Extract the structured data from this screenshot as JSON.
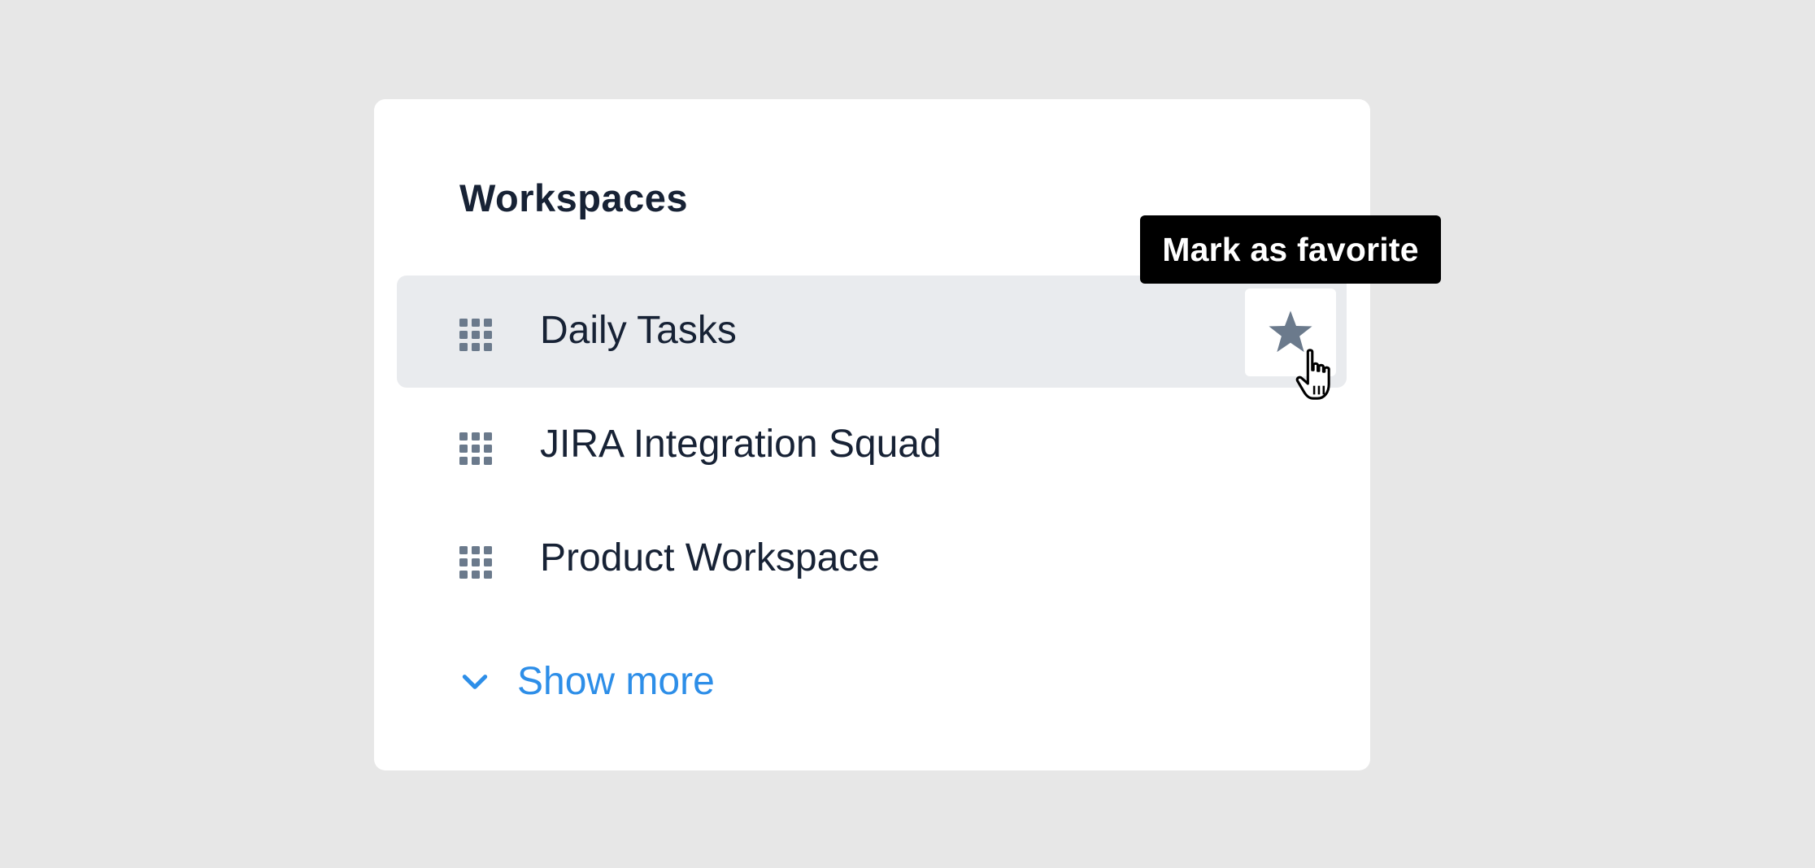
{
  "panel": {
    "title": "Workspaces"
  },
  "workspaces": [
    {
      "label": "Daily Tasks",
      "icon": "grid-icon",
      "hovered": true
    },
    {
      "label": "JIRA Integration Squad",
      "icon": "grid-icon",
      "hovered": false
    },
    {
      "label": "Product Workspace",
      "icon": "grid-icon",
      "hovered": false
    }
  ],
  "favorite_button": {
    "icon": "star-icon",
    "tooltip": "Mark as favorite"
  },
  "show_more": {
    "label": "Show more",
    "icon": "chevron-down-icon"
  },
  "colors": {
    "background": "#e7e7e7",
    "card": "#ffffff",
    "text": "#172235",
    "icon": "#6b7a8c",
    "hover_row": "#e9ebee",
    "link": "#2d8ee8",
    "tooltip_bg": "#000000",
    "tooltip_text": "#ffffff"
  }
}
